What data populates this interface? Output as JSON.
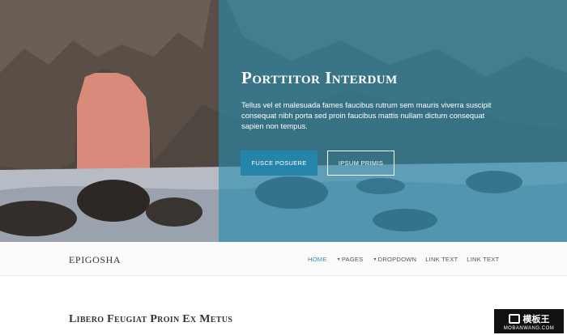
{
  "hero": {
    "title": "Porttitor Interdum",
    "text": "Tellus vel et malesuada fames faucibus rutrum sem mauris viverra suscipit consequat nibh porta sed proin faucibus mattis nullam dictum consequat sapien non tempus.",
    "primary_button": "Fusce Posuere",
    "secondary_button": "Ipsum Primis",
    "overlay_color": "#268caf"
  },
  "nav": {
    "brand": "EPIGOSHA",
    "items": [
      {
        "label": "HOME",
        "active": true,
        "dropdown": false
      },
      {
        "label": "PAGES",
        "active": false,
        "dropdown": true
      },
      {
        "label": "DROPDOWN",
        "active": false,
        "dropdown": true
      },
      {
        "label": "LINK TEXT",
        "active": false,
        "dropdown": false
      },
      {
        "label": "LINK TEXT",
        "active": false,
        "dropdown": false
      }
    ]
  },
  "section": {
    "title": "Libero Feugiat Proin Ex Metus"
  },
  "watermark": {
    "name": "模板王",
    "url": "MOBANWANG.COM"
  }
}
